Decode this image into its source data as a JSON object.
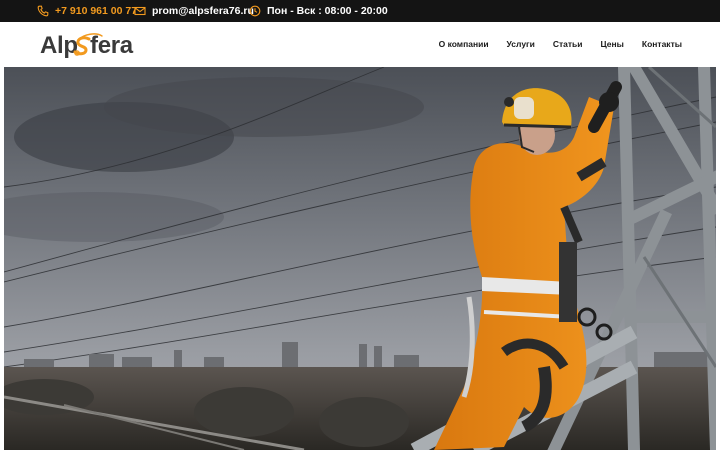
{
  "topbar": {
    "phone": "+7 910 961 00 77",
    "email": "prom@alpsfera76.ru",
    "hours": "Пон - Вск : 08:00 - 20:00",
    "phone_icon": "phone-icon",
    "email_icon": "envelope-icon",
    "hours_icon": "clock-icon",
    "accent": "#f29a1f"
  },
  "brand": {
    "logo_text": "AlpSfera",
    "logo_color": "#3a3a3a",
    "logo_accent": "#f29a1f"
  },
  "nav": {
    "items": [
      {
        "label": "О компании"
      },
      {
        "label": "Услуги"
      },
      {
        "label": "Статьи"
      },
      {
        "label": "Цены"
      },
      {
        "label": "Контакты"
      }
    ]
  },
  "hero": {
    "image": "industrial-climber-on-power-tower-photo"
  }
}
